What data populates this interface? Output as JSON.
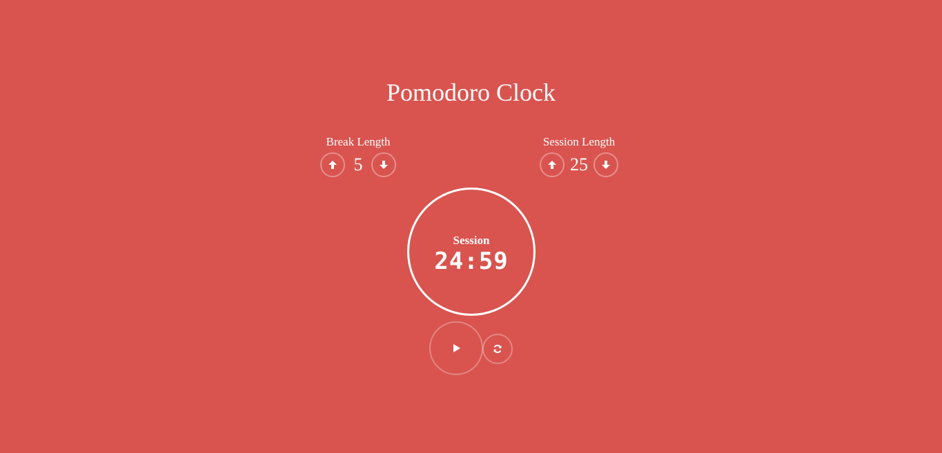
{
  "app": {
    "title": "Pomodoro Clock",
    "background_color": "#d9544f",
    "foreground_color": "#ffffff"
  },
  "break": {
    "label": "Break Length",
    "value": "5",
    "increment_icon": "arrow-up-icon",
    "decrement_icon": "arrow-down-icon"
  },
  "session": {
    "label": "Session Length",
    "value": "25",
    "increment_icon": "arrow-up-icon",
    "decrement_icon": "arrow-down-icon"
  },
  "timer": {
    "label": "Session",
    "time": "24:59"
  },
  "controls": {
    "play_icon": "play-icon",
    "reset_icon": "refresh-icon"
  }
}
